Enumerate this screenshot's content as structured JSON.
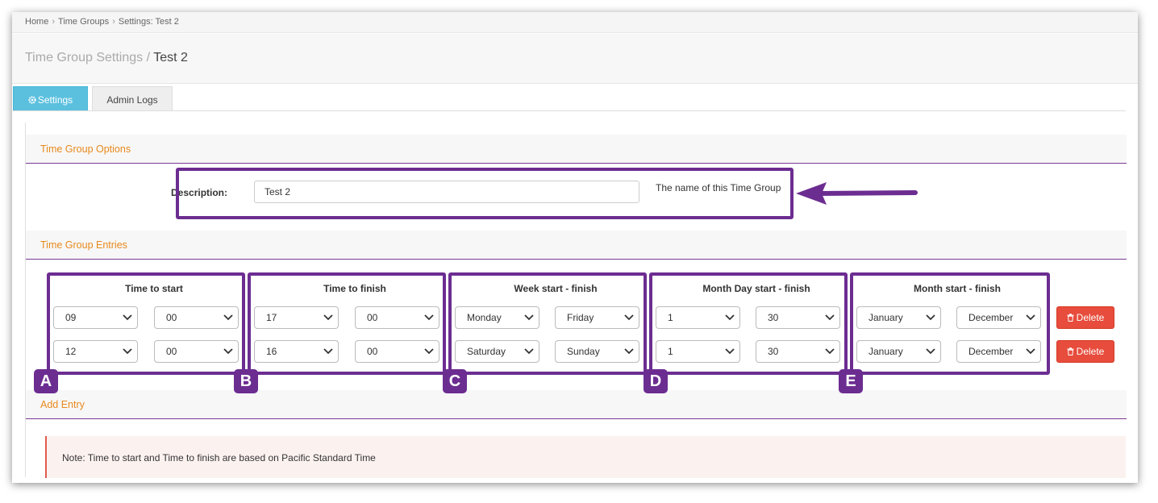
{
  "breadcrumb": [
    "Home",
    "Time Groups",
    "Settings: Test 2"
  ],
  "page_title": {
    "parent": "Time Group Settings",
    "separator": "/",
    "current": "Test 2"
  },
  "tabs": {
    "settings": "Settings",
    "admin_logs": "Admin Logs",
    "settings_icon": "gear-icon"
  },
  "sections": {
    "options": "Time Group Options",
    "entries": "Time Group Entries",
    "add_entry": "Add Entry"
  },
  "description": {
    "label": "Description:",
    "value": "Test 2",
    "help": "The name of this Time Group"
  },
  "columns": [
    "Time to start",
    "Time to finish",
    "Week start - finish",
    "Month Day start - finish",
    "Month start - finish"
  ],
  "entries": [
    {
      "start_hour": "09",
      "start_min": "00",
      "finish_hour": "17",
      "finish_min": "00",
      "week_start": "Monday",
      "week_finish": "Friday",
      "mday_start": "1",
      "mday_finish": "30",
      "month_start": "January",
      "month_finish": "December"
    },
    {
      "start_hour": "12",
      "start_min": "00",
      "finish_hour": "16",
      "finish_min": "00",
      "week_start": "Saturday",
      "week_finish": "Sunday",
      "mday_start": "1",
      "mday_finish": "30",
      "month_start": "January",
      "month_finish": "December"
    }
  ],
  "delete_label": "Delete",
  "note": "Note: Time to start and Time to finish are based on Pacific Standard Time",
  "annotations": {
    "badges": [
      "A",
      "B",
      "C",
      "D",
      "E"
    ],
    "color": "#6c2d91"
  },
  "colors": {
    "accent_tab": "#5bc0de",
    "section_title": "#e8891d",
    "delete": "#e74c3c"
  }
}
